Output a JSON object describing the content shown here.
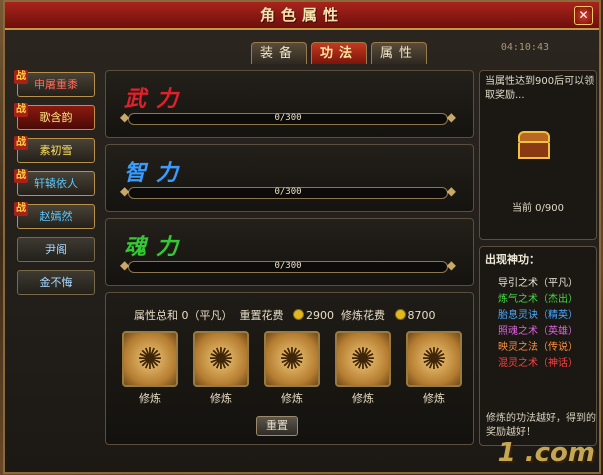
{
  "window": {
    "title": "角色属性",
    "time": "04:10:43"
  },
  "tabs": [
    "装备",
    "功法",
    "属性"
  ],
  "active_tab": "功法",
  "sidebar": [
    {
      "badge": "战",
      "label": "申屠重黍"
    },
    {
      "badge": "战",
      "label": "歌含韵"
    },
    {
      "badge": "战",
      "label": "素初雪"
    },
    {
      "badge": "战",
      "label": "轩辕依人"
    },
    {
      "badge": "战",
      "label": "赵嫣然"
    },
    {
      "badge": "",
      "label": "尹阁"
    },
    {
      "badge": "",
      "label": "金不悔"
    }
  ],
  "attributes": [
    {
      "label": "武力",
      "value": "0/300",
      "color": "#e0202a",
      "progress": 0
    },
    {
      "label": "智力",
      "value": "0/300",
      "color": "#3a9cff",
      "progress": 0
    },
    {
      "label": "魂力",
      "value": "0/300",
      "color": "#34c834",
      "progress": 0
    }
  ],
  "train": {
    "total_label": "属性总和",
    "total_value": "0（平凡）",
    "reset_cost_label": "重置花费",
    "reset_cost": "2900",
    "train_cost_label": "修炼花费",
    "train_cost": "8700",
    "skills": [
      "修炼",
      "修炼",
      "修炼",
      "修炼",
      "修炼"
    ],
    "reset_button": "重置"
  },
  "reward": {
    "note": "当属性达到900后可以领取奖励...",
    "current_label": "当前",
    "current_value": "0/900"
  },
  "skill_panel": {
    "heading": "出现神功：",
    "items": [
      {
        "name": "导引之术（平凡）",
        "color": "#e8e4d8"
      },
      {
        "name": "炼气之术（杰出）",
        "color": "#44d844"
      },
      {
        "name": "胎息灵诀（精英）",
        "color": "#4aa8ff"
      },
      {
        "name": "照魂之术（英雄）",
        "color": "#e060e0"
      },
      {
        "name": "映灵之法（传说）",
        "color": "#ff9040"
      },
      {
        "name": "混灵之术（神话）",
        "color": "#ff4040"
      }
    ],
    "hint": "修炼的功法越好，得到的奖励越好！"
  },
  "watermark": "1 .com"
}
